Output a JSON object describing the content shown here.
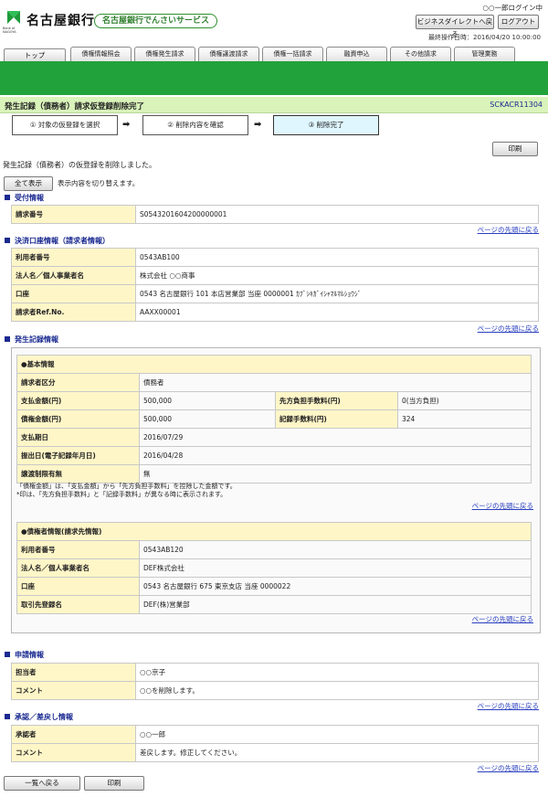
{
  "header": {
    "bank_name": "名古屋銀行",
    "logo_small_text": "Bank of NAGOYA",
    "service_name": "名古屋銀行でんさいサービス",
    "user_login": "○○一郎ログイン中",
    "business_direct_back": "ビジネスダイレクトへ戻る",
    "logout": "ログアウト",
    "last_operation": "最終操作日時：2016/04/20 10:00:00"
  },
  "tabs": {
    "top": "トップ",
    "items": [
      "債権情報照会",
      "債権発生請求",
      "債権譲渡請求",
      "債権一括請求",
      "融資申込",
      "その他請求",
      "管理業務"
    ]
  },
  "page": {
    "title": "発生記録（債務者）請求仮登録削除完了",
    "screen_id": "SCKACR11304"
  },
  "steps": {
    "step1": "① 対象の仮登録を選択",
    "step2": "② 削除内容を確認",
    "step3": "③ 削除完了",
    "arrow": "➡"
  },
  "actions": {
    "print": "印刷",
    "show_all": "全て表示",
    "toggle_text": "表示内容を切り替えます。",
    "back_to_list": "一覧へ戻る",
    "print_bottom": "印刷"
  },
  "messages": {
    "completed": "発生記録（債務者）の仮登録を削除しました。"
  },
  "page_top_link": "ページの先頭に戻る",
  "reception": {
    "heading": "受付情報",
    "rows": [
      {
        "label": "請求番号",
        "value": "S0543201604200000001"
      }
    ]
  },
  "settlement": {
    "heading": "決済口座情報（請求者情報）",
    "rows": [
      {
        "label": "利用者番号",
        "value": "0543AB100"
      },
      {
        "label": "法人名／個人事業者名",
        "value": "株式会社 ○○商事"
      },
      {
        "label": "口座",
        "value": "0543 名古屋銀行  101 本店営業部  当座  0000001 ｶﾌﾞｼｷｶﾞｲｼｬﾏﾙﾏﾙｼｮｳｼﾞ"
      },
      {
        "label": "請求者Ref.No.",
        "value": "AAXX00001"
      }
    ]
  },
  "record": {
    "heading": "発生記録情報",
    "basic_heading": "●基本情報",
    "debtor_type_label": "請求者区分",
    "debtor_type_value": "債務者",
    "amount_label": "支払金額(円)",
    "amount_value": "500,000",
    "fee_burden_label": "先方負担手数料(円)",
    "fee_burden_value": "0(当方負担)",
    "claim_amount_label": "債権金額(円)",
    "claim_amount_value": "500,000",
    "record_fee_label": "記録手数料(円)",
    "record_fee_value": "324",
    "due_date_label": "支払期日",
    "due_date_value": "2016/07/29",
    "issue_date_label": "振出日(電子記録年月日)",
    "issue_date_value": "2016/04/28",
    "transfer_limit_label": "譲渡制限有無",
    "transfer_limit_value": "無",
    "note1": "「債権金額」は、「支払金額」から「先方負担手数料」を控除した金額です。",
    "note2": "*印は、「先方負担手数料」と「記録手数料」が異なる時に表示されます。",
    "creditor_heading": "●債権者情報(請求先情報)",
    "creditor_rows": [
      {
        "label": "利用者番号",
        "value": "0543AB120"
      },
      {
        "label": "法人名／個人事業者名",
        "value": "DEF株式会社"
      },
      {
        "label": "口座",
        "value": "0543 名古屋銀行 675 東京支店 当座 0000022"
      },
      {
        "label": "取引先登録名",
        "value": "DEF(株)営業部"
      }
    ]
  },
  "application": {
    "heading": "申請情報",
    "rows": [
      {
        "label": "担当者",
        "value": "○○京子"
      },
      {
        "label": "コメント",
        "value": "○○を削除します。"
      }
    ]
  },
  "approval": {
    "heading": "承認／差戻し情報",
    "rows": [
      {
        "label": "承認者",
        "value": "○○一郎"
      },
      {
        "label": "コメント",
        "value": "差戻します。修正してください。"
      }
    ]
  },
  "colors": {
    "green_bar": "#22a23a",
    "title_bg": "#d9f3ba",
    "label_bg": "#fff6c8",
    "section_blue": "#1a2a90",
    "link_blue": "#2a3fbf"
  }
}
